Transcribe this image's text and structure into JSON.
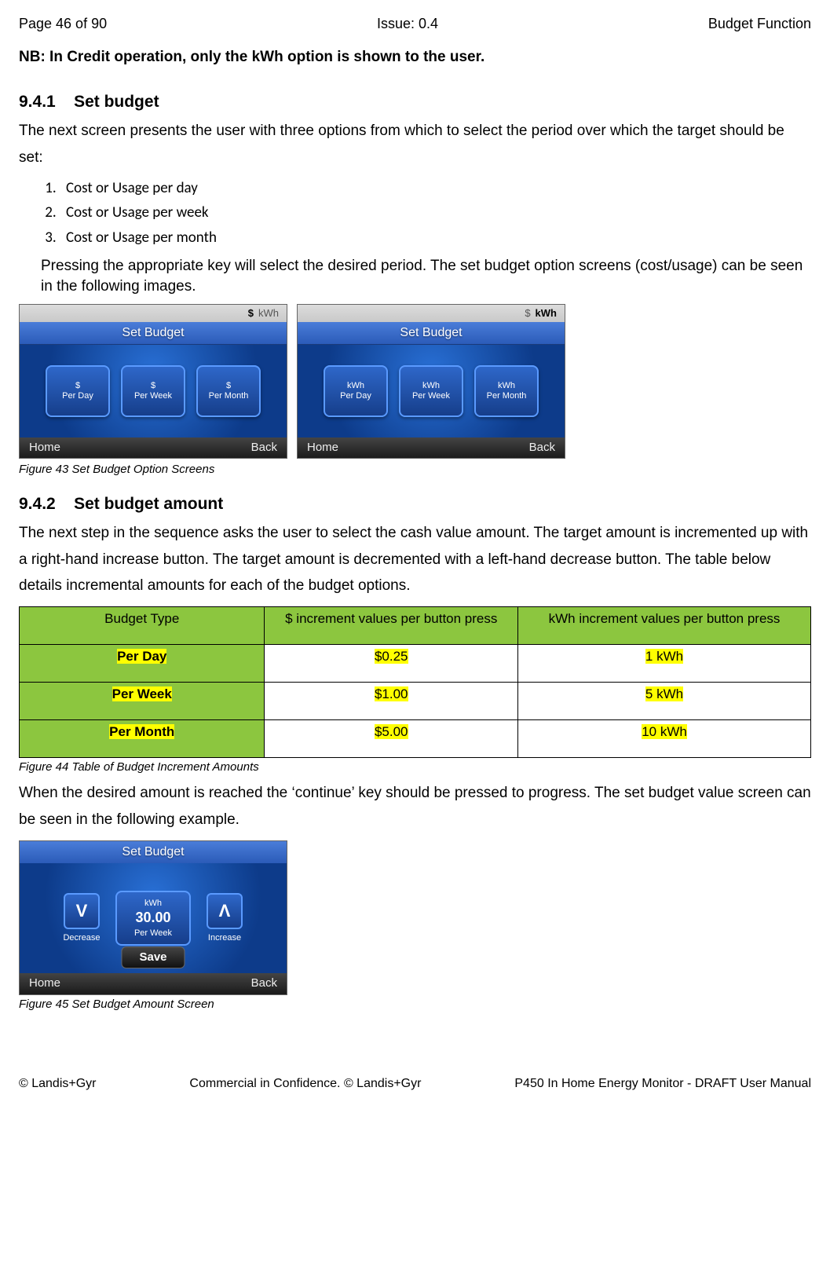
{
  "header": {
    "left": "Page 46 of 90",
    "center": "Issue: 0.4",
    "right": "Budget Function"
  },
  "nb": "NB: In Credit operation, only the kWh option is shown to the user.",
  "sec941": {
    "num": "9.4.1",
    "title": "Set budget",
    "intro": "The next screen presents the user with three options from which to select the period over which the target should be set:",
    "items": [
      "Cost or Usage per day",
      "Cost or Usage per week",
      "Cost or Usage per month"
    ],
    "after": "Pressing the appropriate key will select the desired period. The set budget option screens (cost/usage) can be seen in the following images."
  },
  "device_cost": {
    "top_opts": [
      "$",
      "kWh"
    ],
    "top_active": 0,
    "title": "Set Budget",
    "tiles": [
      {
        "l1": "$",
        "l2": "Per Day"
      },
      {
        "l1": "$",
        "l2": "Per Week"
      },
      {
        "l1": "$",
        "l2": "Per Month"
      }
    ],
    "home": "Home",
    "back": "Back"
  },
  "device_kwh": {
    "top_opts": [
      "$",
      "kWh"
    ],
    "top_active": 1,
    "title": "Set Budget",
    "tiles": [
      {
        "l1": "kWh",
        "l2": "Per Day"
      },
      {
        "l1": "kWh",
        "l2": "Per Week"
      },
      {
        "l1": "kWh",
        "l2": "Per Month"
      }
    ],
    "home": "Home",
    "back": "Back"
  },
  "fig43": "Figure 43 Set Budget Option Screens",
  "sec942": {
    "num": "9.4.2",
    "title": "Set budget amount",
    "p1": "The next step in the sequence asks the user to select the cash value amount. The target amount is incremented up with a right-hand increase button. The target amount is decremented with a left-hand decrease button. The table below details incremental amounts for each of the budget options."
  },
  "chart_data": {
    "type": "table",
    "title": "Table of Budget Increment Amounts",
    "columns": [
      "Budget Type",
      "$ increment values per button press",
      "kWh increment values per button press"
    ],
    "rows": [
      {
        "type": "Per Day",
        "dollar": "$0.25",
        "kwh": "1 kWh"
      },
      {
        "type": "Per Week",
        "dollar": "$1.00",
        "kwh": "5 kWh"
      },
      {
        "type": "Per Month",
        "dollar": "$5.00",
        "kwh": "10 kWh"
      }
    ]
  },
  "fig44": "Figure 44 Table of Budget Increment Amounts",
  "after_table": "When the desired amount is reached the ‘continue’ key should be pressed to progress. The set budget value screen can be seen in the following example.",
  "device_amount": {
    "title": "Set Budget",
    "decrease": "Decrease",
    "increase": "Increase",
    "unit_top": "kWh",
    "value": "30.00",
    "unit_bot": "Per Week",
    "save": "Save",
    "home": "Home",
    "back": "Back"
  },
  "fig45": "Figure 45 Set Budget Amount Screen",
  "footer": {
    "left": "© Landis+Gyr",
    "center": "Commercial in Confidence. © Landis+Gyr",
    "right": "P450 In Home Energy Monitor - DRAFT User Manual"
  }
}
